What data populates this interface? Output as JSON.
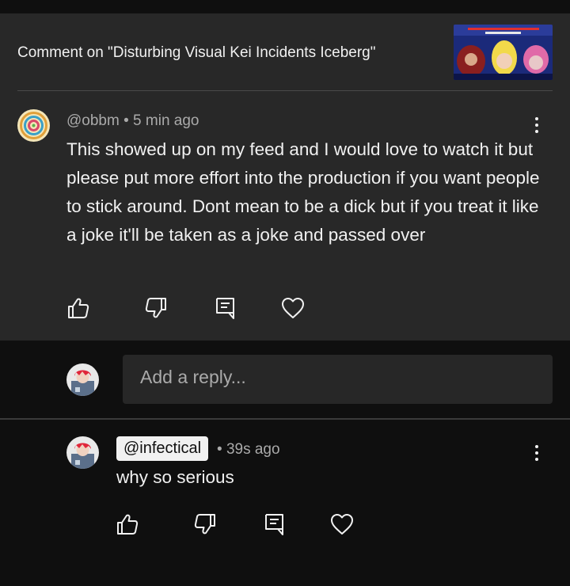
{
  "header": {
    "title": "Comment on \"Disturbing Visual Kei Incidents Iceberg\""
  },
  "comment": {
    "author": "@obbm",
    "separator": "•",
    "time": "5 min ago",
    "text": "This showed up on my feed and I would love to watch it but please put more effort into the production if you want people to stick around. Dont mean to be a dick but if you treat it like a joke it'll be taken as a joke and passed over",
    "actions": [
      "like-icon",
      "dislike-icon",
      "reply-icon",
      "heart-icon"
    ]
  },
  "reply_box": {
    "placeholder": "Add a reply..."
  },
  "reply": {
    "author": "@infectical",
    "separator": "•",
    "time": "39s ago",
    "text": "why so serious",
    "actions": [
      "like-icon",
      "dislike-icon",
      "reply-icon",
      "heart-icon"
    ]
  },
  "colors": {
    "panel_bg": "#282828",
    "page_bg": "#0f0f0f",
    "text": "#f1f1f1",
    "meta": "#aaaaaa"
  }
}
